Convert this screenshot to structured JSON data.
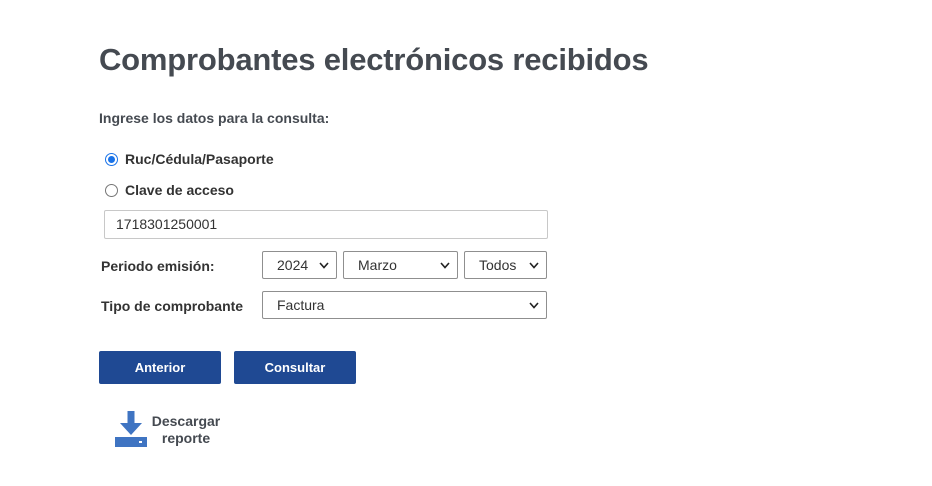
{
  "page": {
    "title": "Comprobantes electrónicos recibidos",
    "subtitle": "Ingrese los datos para la consulta:"
  },
  "search_type": {
    "options": [
      {
        "label": "Ruc/Cédula/Pasaporte",
        "checked": true
      },
      {
        "label": "Clave de acceso",
        "checked": false
      }
    ]
  },
  "identifier_input": {
    "value": "1718301250001"
  },
  "periodo": {
    "label": "Periodo emisión:",
    "year": "2024",
    "month": "Marzo",
    "day": "Todos"
  },
  "tipo": {
    "label": "Tipo de comprobante",
    "value": "Factura"
  },
  "buttons": {
    "previous": "Anterior",
    "consult": "Consultar"
  },
  "download": {
    "line1": "Descargar",
    "line2": "reporte",
    "icon": "download-icon"
  },
  "colors": {
    "primary_button": "#1f4993",
    "download_icon": "#3f74c2",
    "radio_checked": "#1a73e8"
  }
}
